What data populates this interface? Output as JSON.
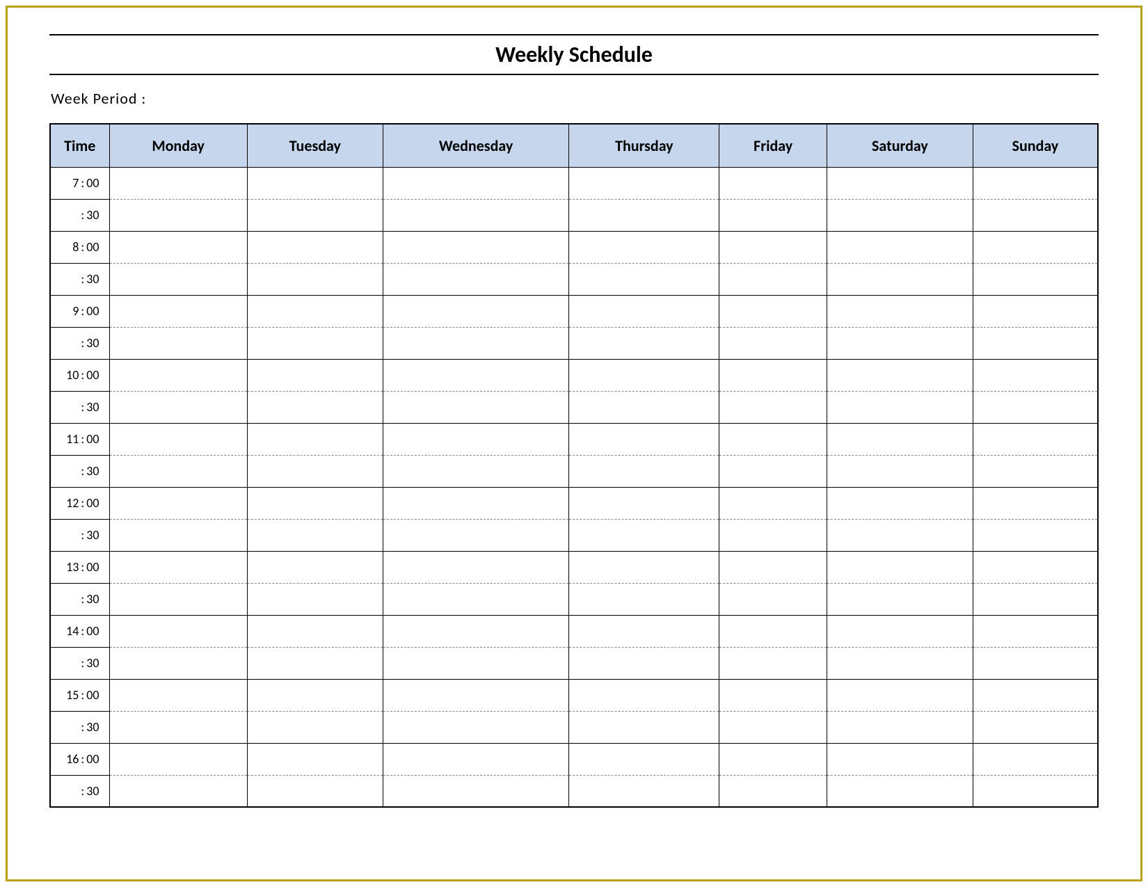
{
  "title": "Weekly Schedule",
  "week_period_label": "Week  Period :",
  "headers": {
    "time": "Time",
    "days": [
      "Monday",
      "Tuesday",
      "Wednesday",
      "Thursday",
      "Friday",
      "Saturday",
      "Sunday"
    ]
  },
  "time_rows": [
    {
      "hour": "7",
      "min": "00"
    },
    {
      "hour": "",
      "min": "30"
    },
    {
      "hour": "8",
      "min": "00"
    },
    {
      "hour": "",
      "min": "30"
    },
    {
      "hour": "9",
      "min": "00"
    },
    {
      "hour": "",
      "min": "30"
    },
    {
      "hour": "10",
      "min": "00"
    },
    {
      "hour": "",
      "min": "30"
    },
    {
      "hour": "11",
      "min": "00"
    },
    {
      "hour": "",
      "min": "30"
    },
    {
      "hour": "12",
      "min": "00"
    },
    {
      "hour": "",
      "min": "30"
    },
    {
      "hour": "13",
      "min": "00"
    },
    {
      "hour": "",
      "min": "30"
    },
    {
      "hour": "14",
      "min": "00"
    },
    {
      "hour": "",
      "min": "30"
    },
    {
      "hour": "15",
      "min": "00"
    },
    {
      "hour": "",
      "min": "30"
    },
    {
      "hour": "16",
      "min": "00"
    },
    {
      "hour": "",
      "min": "30"
    }
  ]
}
